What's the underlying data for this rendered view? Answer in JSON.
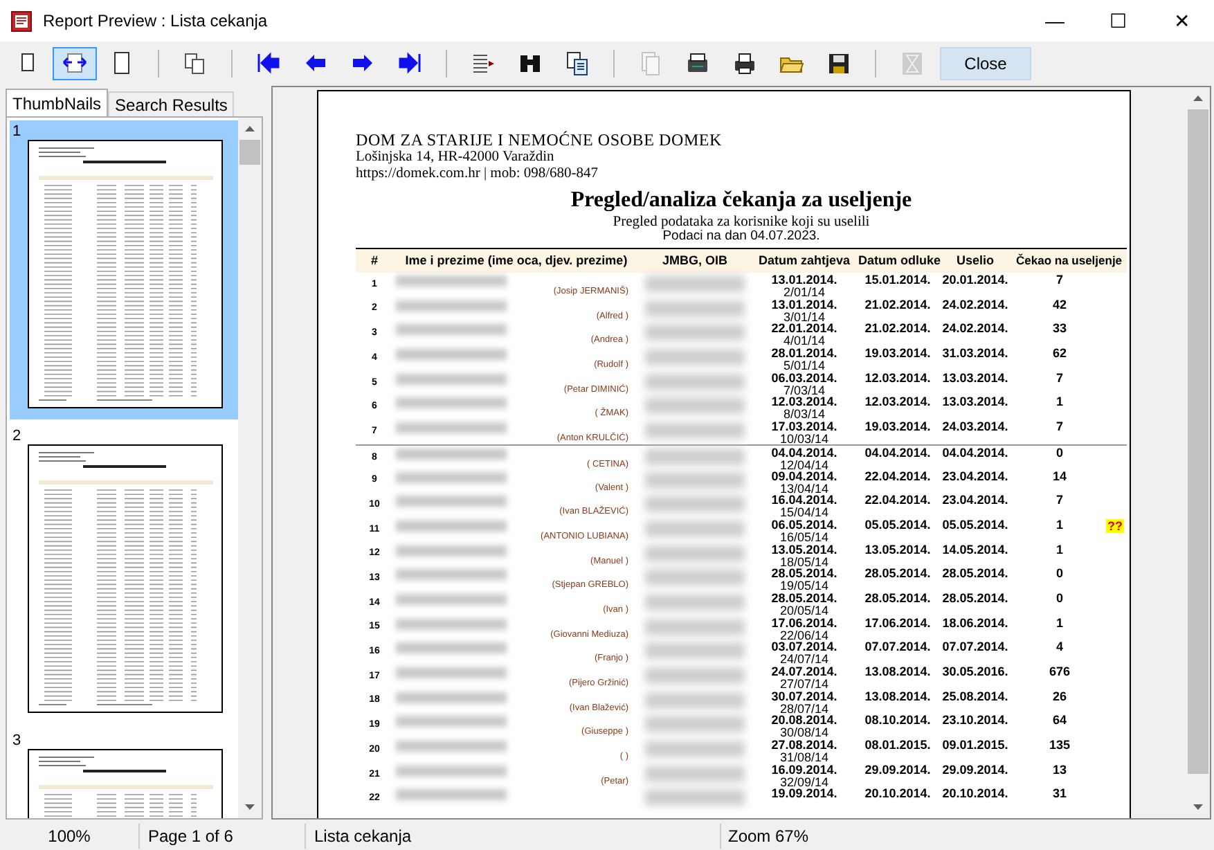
{
  "window": {
    "title": "Report Preview : Lista cekanja",
    "controls": [
      "—",
      "☐",
      "✕"
    ]
  },
  "toolbar": {
    "buttons": [
      {
        "selected": false,
        "disabled": false
      },
      {
        "selected": true,
        "disabled": false
      },
      {
        "selected": false,
        "disabled": false
      },
      {
        "selected": false,
        "disabled": false
      },
      {
        "selected": false,
        "disabled": false
      },
      {
        "selected": false,
        "disabled": false
      },
      {
        "selected": false,
        "disabled": false
      },
      {
        "selected": false,
        "disabled": false
      },
      {
        "selected": false,
        "disabled": false
      },
      {
        "selected": false,
        "disabled": false
      },
      {
        "selected": false,
        "disabled": false
      },
      {
        "selected": false,
        "disabled": true
      },
      {
        "selected": false,
        "disabled": false
      },
      {
        "selected": false,
        "disabled": false
      },
      {
        "selected": false,
        "disabled": false
      },
      {
        "selected": false,
        "disabled": false
      },
      {
        "selected": false,
        "disabled": true
      }
    ],
    "close": "Close"
  },
  "side_tabs": [
    {
      "label": "ThumbNails",
      "selected": true
    },
    {
      "label": "Search Results",
      "selected": false
    }
  ],
  "thumbnails": [
    {
      "label": "1",
      "selected": true
    },
    {
      "label": "2",
      "selected": false
    },
    {
      "label": "3",
      "selected": false
    }
  ],
  "report": {
    "org": "DOM ZA STARIJE I NEMOĆNE OSOBE DOMEK",
    "address": "Lošinjska 14, HR-42000 Varaždin",
    "contact": "https://domek.com.hr | mob: 098/680-847",
    "title": "Pregled/analiza čekanja za useljenje",
    "subtitle": "Pregled podataka za korisnike koji su uselili",
    "date_line": "Podaci na dan 04.07.2023.",
    "columns": [
      "#",
      "Ime i prezime (ime oca, djev. prezime)",
      "JMBG, OIB",
      "Datum zahtjeva",
      "Datum odluke",
      "Uselio",
      "Čekao na useljenje"
    ],
    "rows": [
      {
        "num": "1",
        "parent": "(Josip JERMANIŠ)",
        "requested": "13.01.2014.",
        "ref": "2/01/14",
        "decided": "15.01.2014.",
        "moved_in": "20.01.2014.",
        "days": "7",
        "divider_above": false
      },
      {
        "num": "2",
        "parent": "(Alfred )",
        "requested": "13.01.2014.",
        "ref": "3/01/14",
        "decided": "21.02.2014.",
        "moved_in": "24.02.2014.",
        "days": "42",
        "divider_above": false
      },
      {
        "num": "3",
        "parent": "(Andrea )",
        "requested": "22.01.2014.",
        "ref": "4/01/14",
        "decided": "21.02.2014.",
        "moved_in": "24.02.2014.",
        "days": "33",
        "divider_above": false
      },
      {
        "num": "4",
        "parent": "(Rudolf )",
        "requested": "28.01.2014.",
        "ref": "5/01/14",
        "decided": "19.03.2014.",
        "moved_in": "31.03.2014.",
        "days": "62",
        "divider_above": false
      },
      {
        "num": "5",
        "parent": "(Petar DIMINIĆ)",
        "requested": "06.03.2014.",
        "ref": "7/03/14",
        "decided": "12.03.2014.",
        "moved_in": "13.03.2014.",
        "days": "7",
        "divider_above": false
      },
      {
        "num": "6",
        "parent": "( ŽMAK)",
        "requested": "12.03.2014.",
        "ref": "8/03/14",
        "decided": "12.03.2014.",
        "moved_in": "13.03.2014.",
        "days": "1",
        "divider_above": false
      },
      {
        "num": "7",
        "parent": "(Anton KRULČIĆ)",
        "requested": "17.03.2014.",
        "ref": "10/03/14",
        "decided": "19.03.2014.",
        "moved_in": "24.03.2014.",
        "days": "7",
        "divider_above": false
      },
      {
        "num": "8",
        "parent": "( CETINA)",
        "requested": "04.04.2014.",
        "ref": "12/04/14",
        "decided": "04.04.2014.",
        "moved_in": "04.04.2014.",
        "days": "0",
        "divider_above": true
      },
      {
        "num": "9",
        "parent": "(Valent )",
        "requested": "09.04.2014.",
        "ref": "13/04/14",
        "decided": "22.04.2014.",
        "moved_in": "23.04.2014.",
        "days": "14",
        "divider_above": false
      },
      {
        "num": "10",
        "parent": "(Ivan BLAŽEVIĆ)",
        "requested": "16.04.2014.",
        "ref": "15/04/14",
        "decided": "22.04.2014.",
        "moved_in": "23.04.2014.",
        "days": "7",
        "divider_above": false
      },
      {
        "num": "11",
        "parent": "(ANTONIO LUBIANA)",
        "requested": "06.05.2014.",
        "ref": "16/05/14",
        "decided": "05.05.2014.",
        "moved_in": "05.05.2014.",
        "days": "1",
        "flag": "??",
        "divider_above": false
      },
      {
        "num": "12",
        "parent": "(Manuel )",
        "requested": "13.05.2014.",
        "ref": "18/05/14",
        "decided": "13.05.2014.",
        "moved_in": "14.05.2014.",
        "days": "1",
        "divider_above": false
      },
      {
        "num": "13",
        "parent": "(Stjepan GREBLO)",
        "requested": "28.05.2014.",
        "ref": "19/05/14",
        "decided": "28.05.2014.",
        "moved_in": "28.05.2014.",
        "days": "0",
        "divider_above": false
      },
      {
        "num": "14",
        "parent": "(Ivan )",
        "requested": "28.05.2014.",
        "ref": "20/05/14",
        "decided": "28.05.2014.",
        "moved_in": "28.05.2014.",
        "days": "0",
        "divider_above": false
      },
      {
        "num": "15",
        "parent": "(Giovanni Mediuza)",
        "requested": "17.06.2014.",
        "ref": "22/06/14",
        "decided": "17.06.2014.",
        "moved_in": "18.06.2014.",
        "days": "1",
        "divider_above": false
      },
      {
        "num": "16",
        "parent": "(Franjo )",
        "requested": "03.07.2014.",
        "ref": "24/07/14",
        "decided": "07.07.2014.",
        "moved_in": "07.07.2014.",
        "days": "4",
        "divider_above": false
      },
      {
        "num": "17",
        "parent": "(Pijero Gržinić)",
        "requested": "24.07.2014.",
        "ref": "27/07/14",
        "decided": "13.08.2014.",
        "moved_in": "30.05.2016.",
        "days": "676",
        "divider_above": false
      },
      {
        "num": "18",
        "parent": "(Ivan Blažević)",
        "requested": "30.07.2014.",
        "ref": "28/07/14",
        "decided": "13.08.2014.",
        "moved_in": "25.08.2014.",
        "days": "26",
        "divider_above": false
      },
      {
        "num": "19",
        "parent": "(Giuseppe )",
        "requested": "20.08.2014.",
        "ref": "30/08/14",
        "decided": "08.10.2014.",
        "moved_in": "23.10.2014.",
        "days": "64",
        "divider_above": false
      },
      {
        "num": "20",
        "parent": "( )",
        "requested": "27.08.2014.",
        "ref": "31/08/14",
        "decided": "08.01.2015.",
        "moved_in": "09.01.2015.",
        "days": "135",
        "divider_above": false
      },
      {
        "num": "21",
        "parent": "(Petar)",
        "requested": "16.09.2014.",
        "ref": "32/09/14",
        "decided": "29.09.2014.",
        "moved_in": "29.09.2014.",
        "days": "13",
        "divider_above": false
      },
      {
        "num": "22",
        "requested": "19.09.2014.",
        "decided": "20.10.2014.",
        "moved_in": "20.10.2014.",
        "days": "31",
        "divider_above": false
      }
    ]
  },
  "status_bar": [
    "100%",
    "Page 1 of 6",
    "Lista cekanja",
    "Zoom 67%"
  ]
}
